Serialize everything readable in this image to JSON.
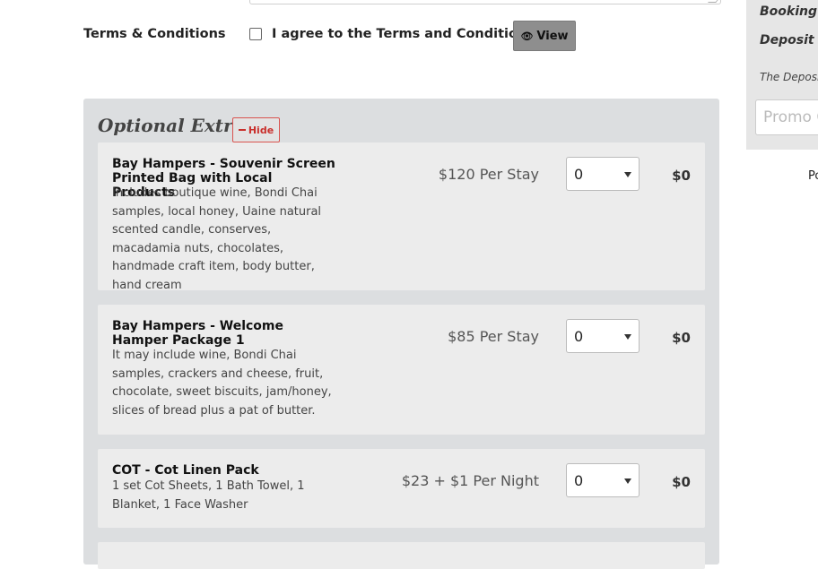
{
  "terms": {
    "label": "Terms & Conditions",
    "agree_text": "I agree to the Terms and Conditions",
    "agree_checked": false,
    "view_button": "View",
    "view_icon": "eye-icon"
  },
  "extras": {
    "title": "Optional Extras",
    "hide_button": "Hide",
    "hide_icon": "minus-icon",
    "items": [
      {
        "name": "Bay Hampers - Souvenir Screen Printed Bag with Local Products",
        "description": "Includes boutique wine, Bondi Chai samples, local honey, Uaine natural scented candle, conserves, macadamia nuts, chocolates, handmade craft item, body butter, hand cream",
        "price": "$120 Per Stay",
        "qty": "0",
        "total": "$0"
      },
      {
        "name": "Bay Hampers - Welcome Hamper Package 1",
        "description": "It may include wine, Bondi Chai samples, crackers and cheese, fruit, chocolate, sweet biscuits, jam/honey, slices of bread plus a pat of butter.",
        "price": "$85 Per Stay",
        "qty": "0",
        "total": "$0"
      },
      {
        "name": "COT - Cot Linen Pack",
        "description": "1 set Cot Sheets, 1 Bath Towel, 1 Blanket, 1 Face Washer",
        "price": "$23 + $1 Per Night",
        "qty": "0",
        "total": "$0"
      }
    ]
  },
  "sidebar": {
    "booking_label": "Booking T",
    "deposit_label": "Deposit D",
    "deposit_note": "The Deposit",
    "promo_placeholder": "Promo C",
    "footer_fragment": "Po"
  }
}
